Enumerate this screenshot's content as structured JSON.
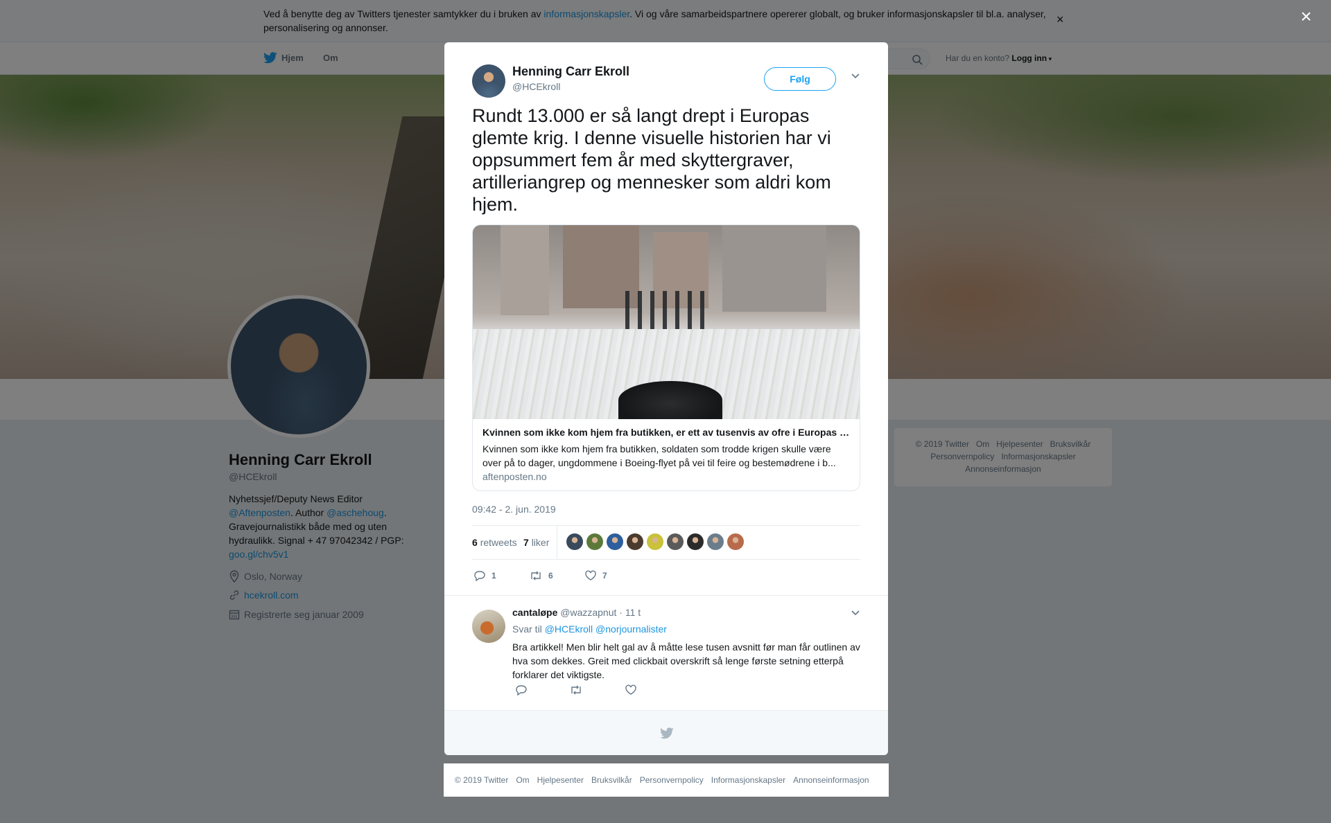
{
  "cookie_bar": {
    "text_before": "Ved å benytte deg av Twitters tjenester samtykker du i bruken av ",
    "link": "informasjonskapsler",
    "text_after": ". Vi og våre samarbeidspartnere opererer globalt, og bruker informasjonskapsler til bl.a. analyser, personalisering og annonser.",
    "close_label": "×"
  },
  "nav": {
    "home": "Hjem",
    "about": "Om",
    "login_prompt": "Har du en konto?",
    "login": "Logg inn"
  },
  "profile": {
    "name": "Henning Carr Ekroll",
    "handle": "@HCEkroll",
    "bio_line1": "Nyhetssjef/Deputy News Editor",
    "bio_link1": "@Aftenposten",
    "bio_mid": ". Author ",
    "bio_link2": "@aschehoug",
    "bio_rest": ". Gravejournalistikk både med og uten hydraulikk. Signal + 47 97042342 / PGP:",
    "bio_link3": "goo.gl/chv5v1",
    "location": "Oslo, Norway",
    "website": "hcekroll.com",
    "joined": "Registrerte seg januar 2009"
  },
  "side_footer": [
    "© 2019 Twitter",
    "Om",
    "Hjelpesenter",
    "Bruksvilkår",
    "Personvernpolicy",
    "Informasjonskapsler",
    "Annonseinformasjon"
  ],
  "modal_close": "×",
  "tweet": {
    "author_name": "Henning Carr Ekroll",
    "author_handle": "@HCEkroll",
    "follow_label": "Følg",
    "text": "Rundt 13.000 er så langt drept i Europas glemte krig. I denne visuelle historien har vi oppsummert fem år med skyttergraver, artilleriangrep og mennesker som aldri kom hjem.",
    "card": {
      "title": "Kvinnen som ikke kom hjem fra butikken, er ett av tusenvis av ofre i Europas glemte krig",
      "description": "Kvinnen som ikke kom hjem fra butikken, soldaten som trodde krigen skulle være over på to dager, ungdommene i Boeing-flyet på vei til feire og bestemødrene i b...",
      "domain": "aftenposten.no"
    },
    "timestamp": "09:42 - 2. jun. 2019",
    "retweets_count": "6",
    "retweets_label": "retweets",
    "likes_count": "7",
    "likes_label": "liker",
    "actions": {
      "reply_count": "1",
      "retweet_count": "6",
      "like_count": "7"
    },
    "liker_colors": [
      "#3a4a5c",
      "#5b7a3a",
      "#2d5f9e",
      "#4a3b2e",
      "#c9c23a",
      "#5a5a5a",
      "#2b2b2b",
      "#6b7d8c",
      "#b86b4b"
    ]
  },
  "reply": {
    "name": "cantaløpe",
    "handle": "@wazzapnut",
    "time": "· 11 t",
    "replying_to_label": "Svar til",
    "mention1": "@HCEkroll",
    "mention2": "@norjournalister",
    "text": "Bra artikkel! Men blir helt gal av å måtte lese tusen avsnitt før man får outlinen av hva som dekkes. Greit med clickbait overskrift så lenge første setning etterpå forklarer det viktigste."
  },
  "bottom_footer": [
    "© 2019 Twitter",
    "Om",
    "Hjelpesenter",
    "Bruksvilkår",
    "Personvernpolicy",
    "Informasjonskapsler",
    "Annonseinformasjon"
  ],
  "colors": {
    "twitter_blue": "#1da1f2",
    "link_blue": "#1b95e0",
    "muted": "#657786"
  }
}
